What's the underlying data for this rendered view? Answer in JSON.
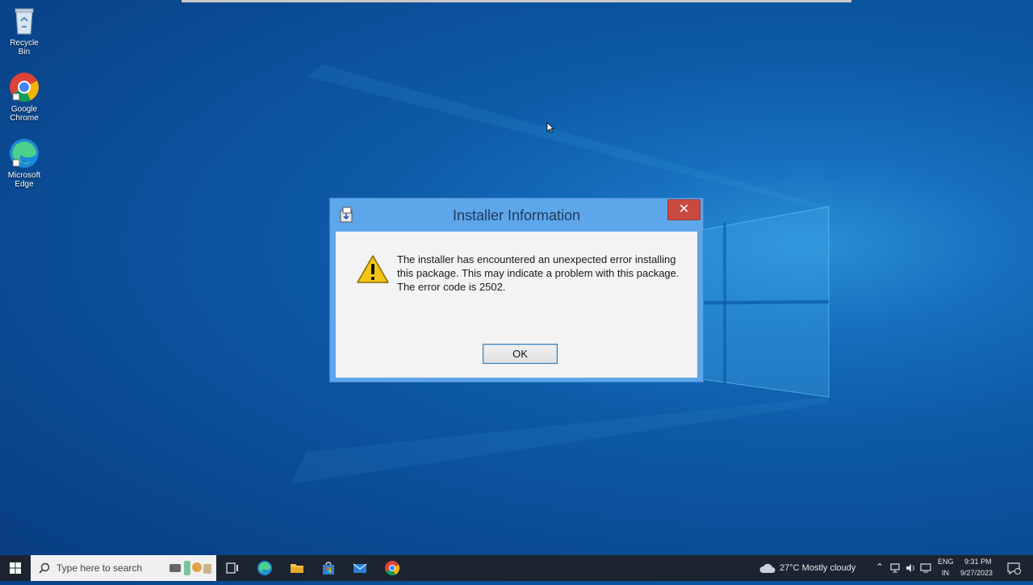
{
  "desktop": {
    "icons": [
      {
        "label": "Recycle Bin",
        "icon": "recycle-bin-icon"
      },
      {
        "label": "Google Chrome",
        "icon": "chrome-icon"
      },
      {
        "label": "Microsoft Edge",
        "icon": "edge-icon"
      }
    ]
  },
  "dialog": {
    "title": "Installer Information",
    "close_label": "✕",
    "message": "The installer has encountered an unexpected error installing this package. This may indicate a problem with this package. The error code is 2502.",
    "ok_label": "OK",
    "icon": "warning-icon"
  },
  "taskbar": {
    "search_placeholder": "Type here to search",
    "pinned": [
      "task-view-icon",
      "edge-icon",
      "file-explorer-icon",
      "store-icon",
      "mail-icon",
      "chrome-icon"
    ],
    "weather": "27°C  Mostly cloudy",
    "lang_top": "ENG",
    "lang_bottom": "IN",
    "time": "9:31 PM",
    "date": "9/27/2023"
  },
  "colors": {
    "dialog_frame": "#5ea6ea",
    "close_button": "#c94a40",
    "taskbar": "#1b2430"
  }
}
